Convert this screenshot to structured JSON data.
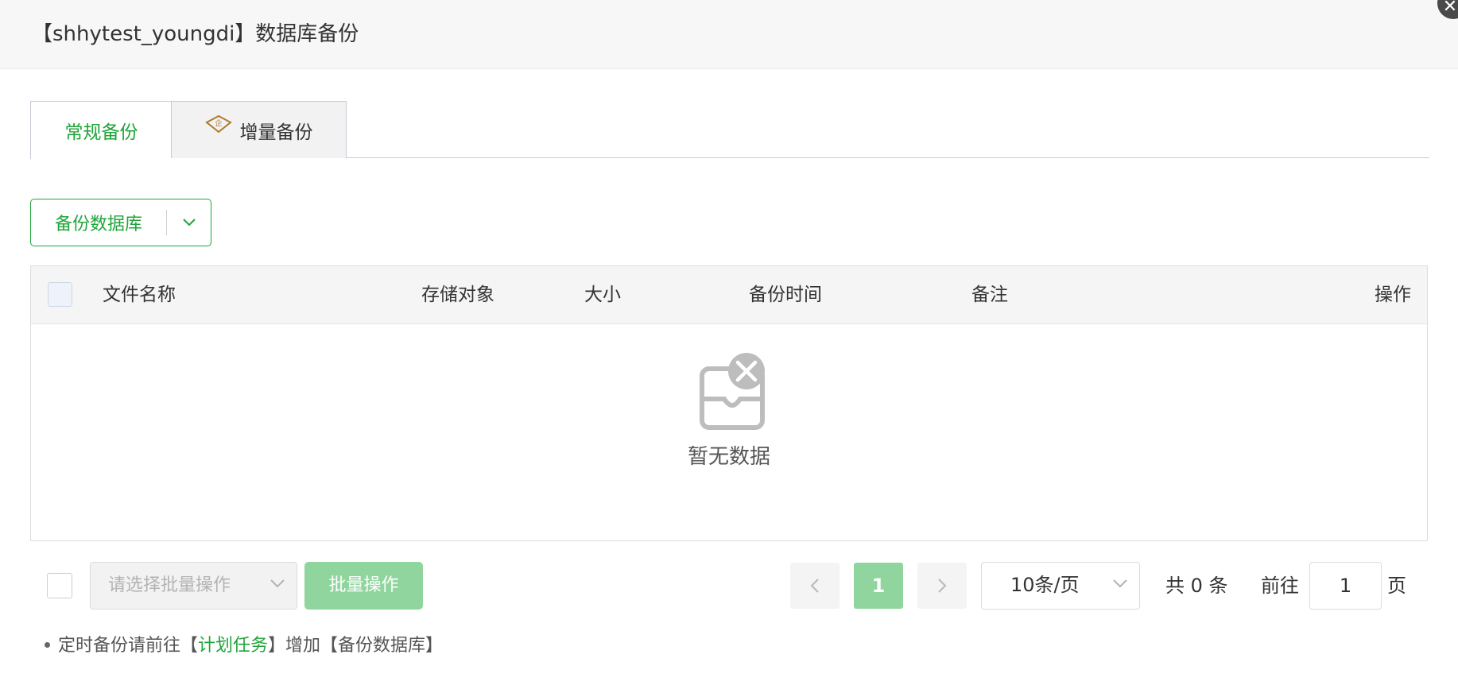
{
  "dialog": {
    "title": "【shhytest_youngdi】数据库备份",
    "close_icon": "close-icon"
  },
  "tabs": [
    {
      "label": "常规备份",
      "active": true
    },
    {
      "label": "增量备份",
      "active": false,
      "icon": "enterprise-diamond-icon"
    }
  ],
  "toolbar": {
    "backup_label": "备份数据库",
    "dropdown_icon": "chevron-down-icon"
  },
  "table": {
    "columns": [
      "文件名称",
      "存储对象",
      "大小",
      "备份时间",
      "备注",
      "操作"
    ],
    "rows": [],
    "empty_text": "暂无数据",
    "empty_icon": "empty-inbox-icon"
  },
  "batch": {
    "select_placeholder": "请选择批量操作",
    "button_label": "批量操作"
  },
  "pagination": {
    "current_page": "1",
    "page_size": "10条/页",
    "total_text": "共 0 条",
    "goto_prefix": "前往",
    "goto_value": "1",
    "goto_suffix": "页"
  },
  "tip": {
    "prefix": "定时备份请前往【",
    "link": "计划任务",
    "suffix": "】增加【备份数据库】"
  },
  "colors": {
    "brand_green": "#20a53a",
    "disabled_green": "#90d59e",
    "enterprise_gold": "#b07a2c"
  }
}
